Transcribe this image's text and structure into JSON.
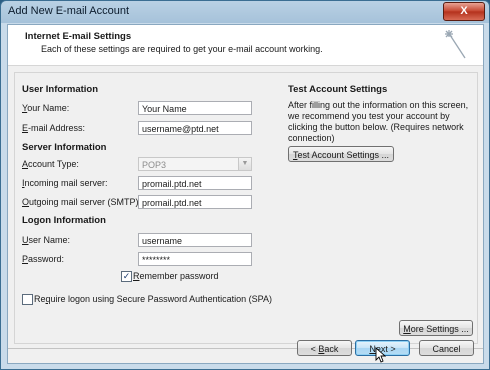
{
  "window": {
    "title": "Add New E-mail Account",
    "close_glyph": "X"
  },
  "header": {
    "title": "Internet E-mail Settings",
    "subtitle": "Each of these settings are required to get your e-mail account working."
  },
  "user_info": {
    "heading": "User Information",
    "name_label_accel": "Y",
    "name_label_rest": "our Name:",
    "name_value": "Your Name",
    "email_label_accel": "E",
    "email_label_rest": "-mail Address:",
    "email_value": "username@ptd.net"
  },
  "server_info": {
    "heading": "Server Information",
    "account_type_label_accel": "A",
    "account_type_label_rest": "ccount Type:",
    "account_type_value": "POP3",
    "incoming_label_accel": "I",
    "incoming_label_rest": "ncoming mail server:",
    "incoming_value": "promail.ptd.net",
    "outgoing_label_accel": "O",
    "outgoing_label_rest": "utgoing mail server (SMTP):",
    "outgoing_value": "promail.ptd.net"
  },
  "logon_info": {
    "heading": "Logon Information",
    "username_label_accel": "U",
    "username_label_rest": "ser Name:",
    "username_value": "username",
    "password_label_accel": "P",
    "password_label_rest": "assword:",
    "password_value": "********",
    "remember_accel": "R",
    "remember_rest": "emember password",
    "remember_checked": true,
    "spa_accel": "q",
    "spa_pre": "Re",
    "spa_rest": "uire logon using Secure Password Authentication (SPA)",
    "spa_checked": false
  },
  "test_settings": {
    "heading": "Test Account Settings",
    "description": "After filling out the information on this screen, we recommend you test your account by clicking the button below. (Requires network connection)",
    "button_accel": "T",
    "button_rest": "est Account Settings ..."
  },
  "more_settings": {
    "accel": "M",
    "rest": "ore Settings ..."
  },
  "footer": {
    "back_pre": "< ",
    "back_accel": "B",
    "back_rest": "ack",
    "next_accel": "N",
    "next_rest": "ext >",
    "cancel": "Cancel"
  }
}
